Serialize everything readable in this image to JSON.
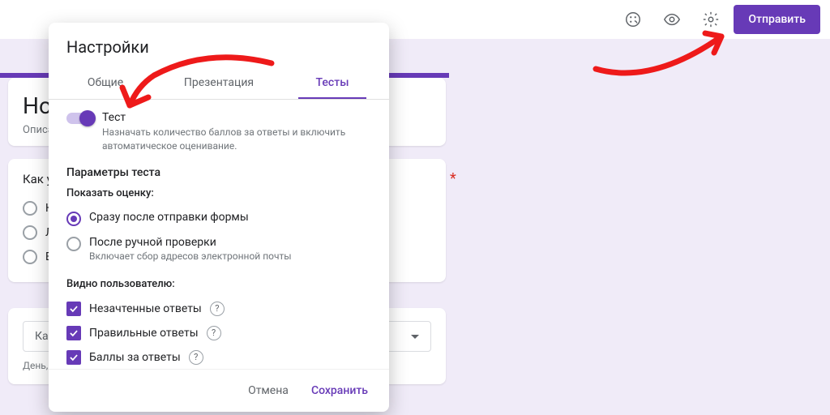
{
  "topbar": {
    "send": "Отправить"
  },
  "form": {
    "title": "Нова",
    "description": "Описание",
    "q1": {
      "title": "Как узна",
      "options": [
        "Ника",
        "Легк",
        "Вари"
      ]
    },
    "q2": {
      "select_placeholder": "Как уз",
      "sub": "День, ме"
    },
    "required_mark": "*"
  },
  "modal": {
    "title": "Настройки",
    "tabs": [
      "Общие",
      "Презентация",
      "Тесты"
    ],
    "active_tab": 2,
    "quiz": {
      "toggle_label": "Тест",
      "toggle_desc": "Назначать количество баллов за ответы и включить автоматическое оценивание.",
      "toggle_on": true
    },
    "params_heading": "Параметры теста",
    "show_grade": {
      "heading": "Показать оценку:",
      "opt1": "Сразу после отправки формы",
      "opt2": "После ручной проверки",
      "opt2_sub": "Включает сбор адресов электронной почты",
      "selected": 0
    },
    "visible": {
      "heading": "Видно пользователю:",
      "items": [
        "Незачтенные ответы",
        "Правильные ответы",
        "Баллы за ответы"
      ]
    },
    "footer": {
      "cancel": "Отмена",
      "save": "Сохранить"
    }
  }
}
